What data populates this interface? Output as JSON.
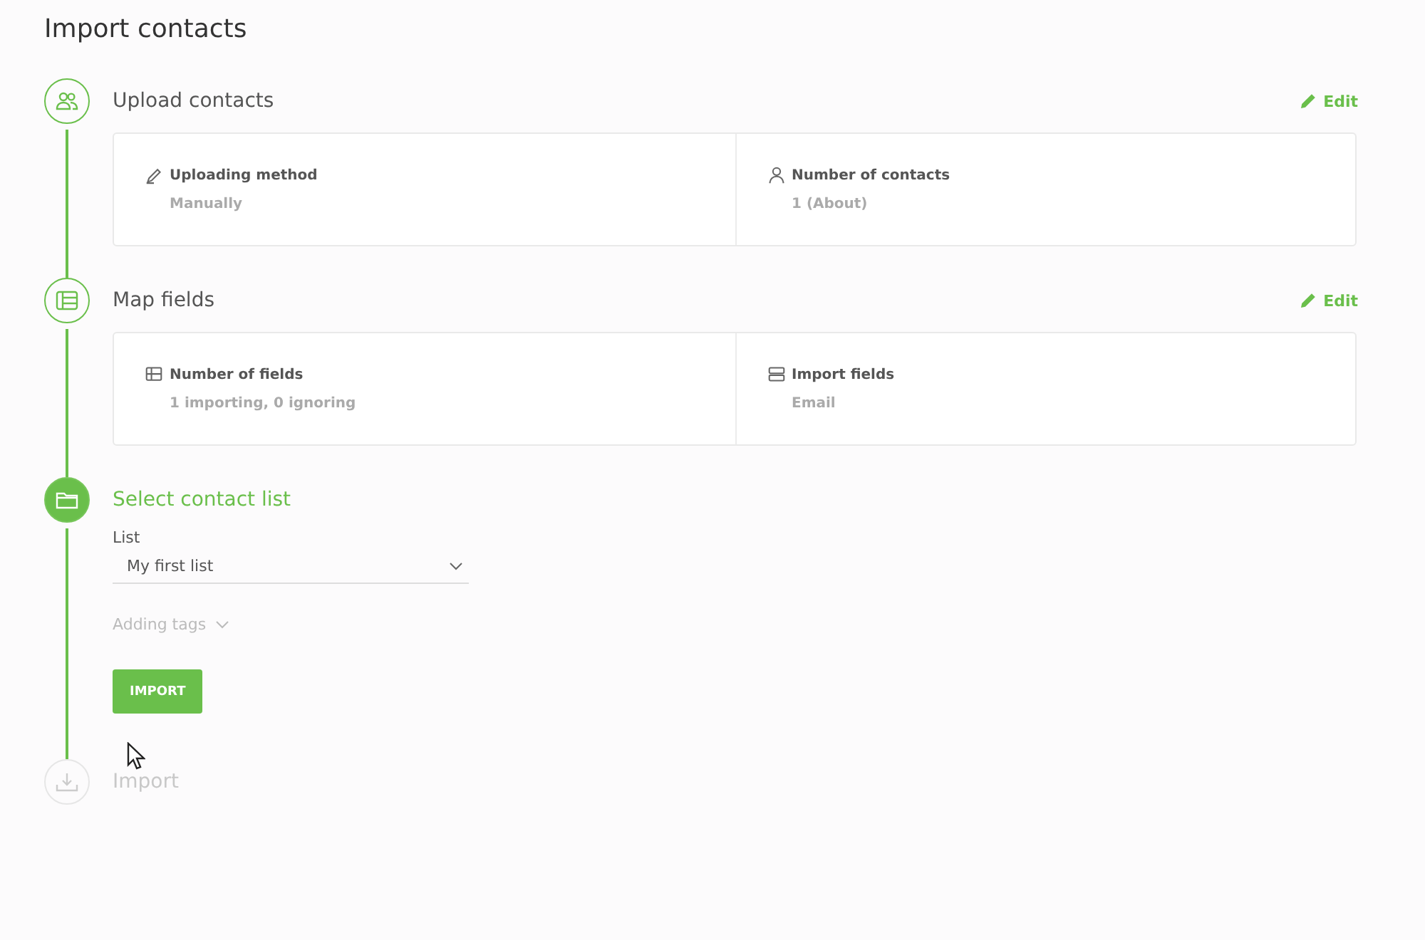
{
  "page": {
    "title": "Import contacts"
  },
  "steps": [
    {
      "title": "Upload contacts",
      "completed": true,
      "current": false,
      "edit_label": "Edit",
      "details": [
        {
          "label": "Uploading method",
          "value": "Manually"
        },
        {
          "label": "Number of contacts",
          "value": "1 (About)"
        }
      ]
    },
    {
      "title": "Map fields",
      "completed": true,
      "current": false,
      "edit_label": "Edit",
      "details": [
        {
          "label": "Number of fields",
          "value": "1 importing, 0 ignoring"
        },
        {
          "label": "Import fields",
          "value": "Email"
        }
      ]
    },
    {
      "title": "Select contact list",
      "completed": false,
      "current": true,
      "form": {
        "list_label": "List",
        "list_value": "My first list",
        "tags_label": "Adding tags",
        "tags_expanded": false,
        "button": "IMPORT"
      }
    },
    {
      "title": "Import",
      "completed": false,
      "current": false
    }
  ]
}
